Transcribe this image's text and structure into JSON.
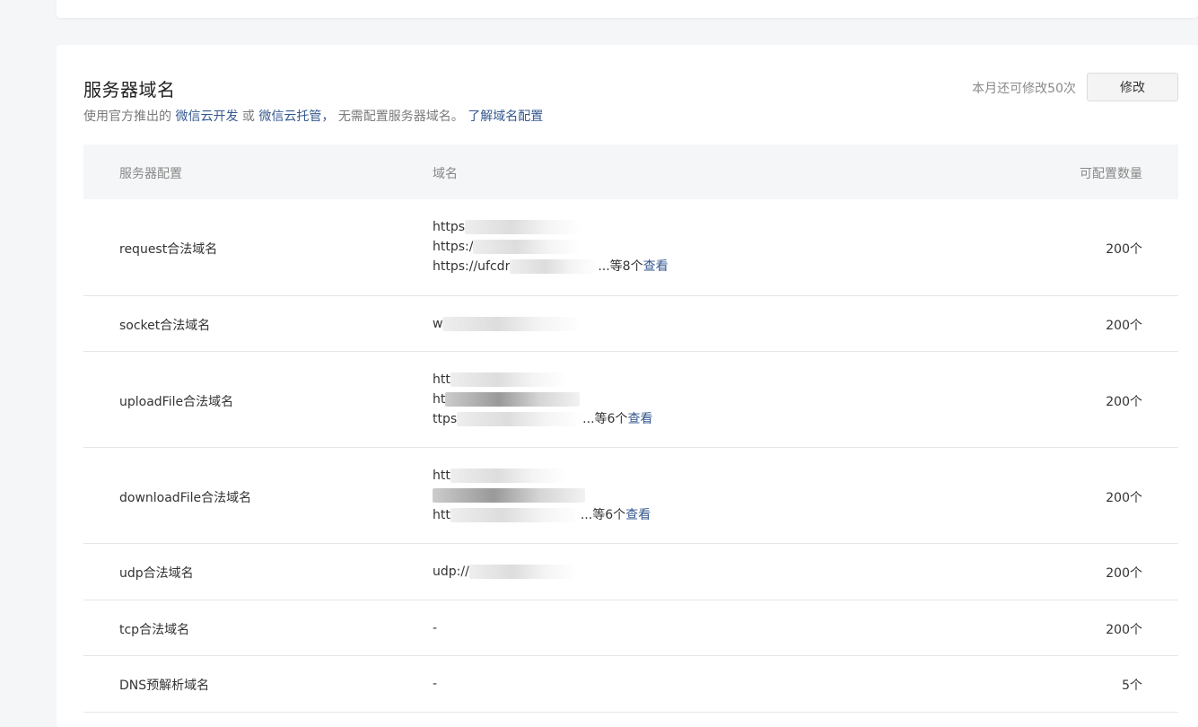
{
  "section": {
    "title": "服务器域名",
    "desc_prefix": "使用官方推出的",
    "link_cloud_dev": "微信云开发",
    "desc_or": "或",
    "link_cloud_host": "微信云托管，",
    "desc_suffix": "无需配置服务器域名。",
    "link_learn": "了解域名配置",
    "quota_text": "本月还可修改50次",
    "edit_button": "修改"
  },
  "table": {
    "headers": {
      "config": "服务器配置",
      "domain": "域名",
      "count": "可配置数量"
    },
    "rows": [
      {
        "name": "request合法域名",
        "lines": [
          "https",
          "https:/",
          "https://ufcdr"
        ],
        "more": "...等8个",
        "view": "查看",
        "count": "200个"
      },
      {
        "name": "socket合法域名",
        "lines": [
          "w"
        ],
        "more": "",
        "view": "",
        "count": "200个"
      },
      {
        "name": "uploadFile合法域名",
        "lines": [
          "htt",
          "ht",
          "ttps"
        ],
        "more": "...等6个",
        "view": "查看",
        "count": "200个"
      },
      {
        "name": "downloadFile合法域名",
        "lines": [
          "htt",
          "",
          "htt"
        ],
        "more": "...等6个",
        "view": "查看",
        "count": "200个"
      },
      {
        "name": "udp合法域名",
        "lines": [
          "udp://"
        ],
        "more": "",
        "view": "",
        "count": "200个"
      },
      {
        "name": "tcp合法域名",
        "lines": [
          "-"
        ],
        "more": "",
        "view": "",
        "count": "200个"
      },
      {
        "name": "DNS预解析域名",
        "lines": [
          "-"
        ],
        "more": "",
        "view": "",
        "count": "5个"
      }
    ]
  }
}
